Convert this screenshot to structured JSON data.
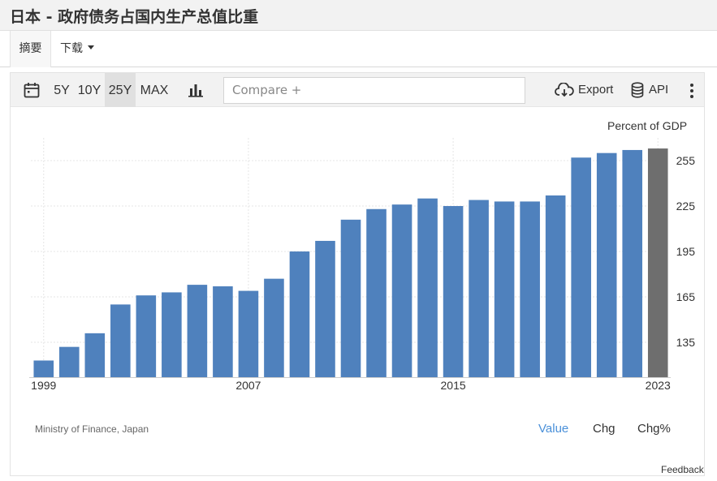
{
  "page": {
    "title": "日本 - 政府债务占国内生产总值比重"
  },
  "tabs": {
    "summary": "摘要",
    "download": "下载"
  },
  "toolbar": {
    "range_buttons": [
      "5Y",
      "10Y",
      "25Y",
      "MAX"
    ],
    "selected_range": "25Y",
    "compare_placeholder": "Compare +",
    "export_label": "Export",
    "api_label": "API"
  },
  "chart_data": {
    "type": "bar",
    "unit_label": "Percent of GDP",
    "categories": [
      "1999",
      "2000",
      "2001",
      "2002",
      "2003",
      "2004",
      "2005",
      "2006",
      "2007",
      "2008",
      "2009",
      "2010",
      "2011",
      "2012",
      "2013",
      "2014",
      "2015",
      "2016",
      "2017",
      "2018",
      "2019",
      "2020",
      "2021",
      "2022",
      "2023"
    ],
    "x_tick_labels": [
      "1999",
      "2007",
      "2015",
      "2023"
    ],
    "values": [
      123,
      132,
      141,
      160,
      166,
      168,
      173,
      172,
      169,
      177,
      195,
      202,
      216,
      223,
      226,
      230,
      225,
      229,
      228,
      228,
      232,
      257,
      260,
      262,
      263
    ],
    "highlight_last": true,
    "bar_color": "#4f81bd",
    "highlight_color": "#6e6e6e",
    "y_ticks": [
      135,
      165,
      195,
      225,
      255
    ],
    "ylim": [
      112,
      270
    ],
    "grid": true
  },
  "footer": {
    "source": "Ministry of Finance, Japan",
    "value_modes": [
      "Value",
      "Chg",
      "Chg%"
    ],
    "active_mode": "Value",
    "feedback": "Feedback"
  },
  "colors": {
    "accent": "#4a90d9",
    "bar": "#4f81bd",
    "latest_bar": "#6e6e6e"
  }
}
